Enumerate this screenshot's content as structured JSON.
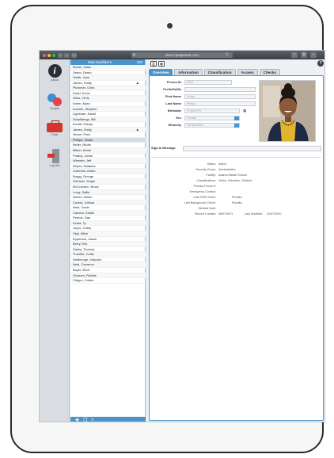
{
  "browser": {
    "url": "demo.beaptrack.com",
    "lock_icon": "lock-icon",
    "refresh_icon": "refresh-icon",
    "dot_colors": [
      "#ff5f57",
      "#febc2e",
      "#28c840"
    ]
  },
  "rail": {
    "items": [
      {
        "label": "About",
        "icon": "info-icon"
      },
      {
        "label": "People",
        "icon": "people-icon"
      },
      {
        "label": "Tools",
        "icon": "toolbox-icon"
      },
      {
        "label": "Log Out",
        "icon": "logout-icon"
      }
    ]
  },
  "list": {
    "header_label": "Date Modified ▾",
    "header_count": "250",
    "items": [
      {
        "name": "Brown, Isaac"
      },
      {
        "name": "Demo, Demo"
      },
      {
        "name": "Smith, John"
      },
      {
        "name": "James, Emily",
        "warn": true
      },
      {
        "name": "Plummer, Chris"
      },
      {
        "name": "Dodd, Kevin"
      },
      {
        "name": "Giles, Chris"
      },
      {
        "name": "Karim, Myra"
      },
      {
        "name": "Kunzler, Stephen"
      },
      {
        "name": "Lightman, David"
      },
      {
        "name": "Schpilbergs, Bill"
      },
      {
        "name": "Everitt, Randy"
      },
      {
        "name": "James, Emily",
        "warn": true
      },
      {
        "name": "Simon, Fred"
      },
      {
        "name": "Phelps, Vivian",
        "selected": true
      },
      {
        "name": "Beller, Micah"
      },
      {
        "name": "Milton, Kendi"
      },
      {
        "name": "Pratley, Jamie"
      },
      {
        "name": "Wheeler, Jeff"
      },
      {
        "name": "Reyes, Natasha"
      },
      {
        "name": "Coleman, Anton"
      },
      {
        "name": "Bragg, George"
      },
      {
        "name": "Garrison, Roger"
      },
      {
        "name": "McCracken, Brock"
      },
      {
        "name": "Long, Gallie"
      },
      {
        "name": "Nunez, Alison"
      },
      {
        "name": "Cooley, Joshua"
      },
      {
        "name": "Neal, Gavin"
      },
      {
        "name": "Camino, Kelsie"
      },
      {
        "name": "Pearce, Dan"
      },
      {
        "name": "Kolda, Ty"
      },
      {
        "name": "Joyce, Cathy"
      },
      {
        "name": "Vigil, Mitch"
      },
      {
        "name": "Epperson, Jason"
      },
      {
        "name": "Berry, Eric"
      },
      {
        "name": "Dailey, Thomas"
      },
      {
        "name": "Trumble, Collin"
      },
      {
        "name": "Walbrough, Malcolm"
      },
      {
        "name": "Neal, Cameron"
      },
      {
        "name": "Boyer, Brett"
      },
      {
        "name": "Grissom, Robbie"
      },
      {
        "name": "Chipps, Colton"
      }
    ],
    "footer_icons": [
      "add-icon",
      "duplicate-icon",
      "search-icon"
    ]
  },
  "detail": {
    "tabs": [
      "Overview",
      "Information",
      "Classification",
      "Access",
      "Checks"
    ],
    "active_tab": "Overview",
    "fields": {
      "person_id": {
        "label": "Person ID",
        "value": "2003"
      },
      "prefix": {
        "label": "Prefix/Suffix",
        "value": ""
      },
      "first_name": {
        "label": "First Name",
        "value": "Vivian"
      },
      "last_name": {
        "label": "Last Name",
        "value": "Phelps"
      },
      "birthdate": {
        "label": "Birthdate",
        "value": "07/06/1970"
      },
      "sex": {
        "label": "Sex",
        "value": "Female"
      },
      "ethnicity": {
        "label": "Ethnicity",
        "value": "Not specified"
      }
    },
    "signin": {
      "label": "Sign-In Message",
      "value": ""
    },
    "summary": {
      "status": {
        "label": "Status:",
        "value": "Active"
      },
      "security_group": {
        "label": "Security Group:",
        "value": "Administrator"
      },
      "facility": {
        "label": "Facility:",
        "value": "Adams Middle School"
      },
      "classifications": {
        "label": "Classifications:",
        "value": "Visitor, Volunteer, Student"
      },
      "primary_phone": {
        "label": "Primary Phone #:",
        "value": ""
      },
      "emergency": {
        "label": "Emergency Contact:",
        "value": ""
      },
      "last_sor": {
        "label": "Last SOR Check:",
        "value": "",
        "result_label": "Results:"
      },
      "last_bg": {
        "label": "Last Background Check:",
        "value": "",
        "result_label": "Results:"
      },
      "medical": {
        "label": "Medical Note:",
        "value": ""
      },
      "record_created": {
        "label": "Record Created:",
        "value": "08/07/2021",
        "modified_label": "Last Modified:",
        "modified_value": "01/07/2020"
      }
    },
    "colors": {
      "accent": "#4a94c9",
      "alert": "#d6342f"
    }
  }
}
